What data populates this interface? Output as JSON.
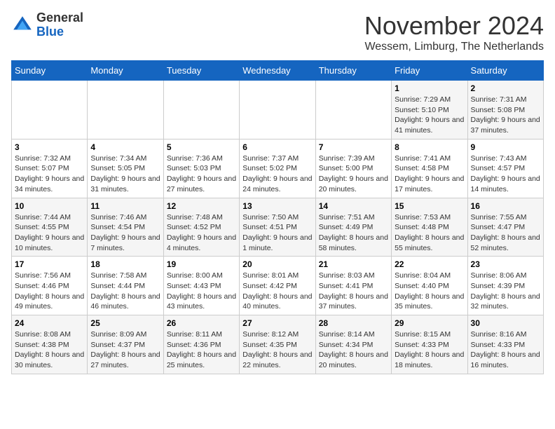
{
  "logo": {
    "general": "General",
    "blue": "Blue"
  },
  "title": "November 2024",
  "subtitle": "Wessem, Limburg, The Netherlands",
  "days_of_week": [
    "Sunday",
    "Monday",
    "Tuesday",
    "Wednesday",
    "Thursday",
    "Friday",
    "Saturday"
  ],
  "weeks": [
    [
      {
        "day": "",
        "info": ""
      },
      {
        "day": "",
        "info": ""
      },
      {
        "day": "",
        "info": ""
      },
      {
        "day": "",
        "info": ""
      },
      {
        "day": "",
        "info": ""
      },
      {
        "day": "1",
        "info": "Sunrise: 7:29 AM\nSunset: 5:10 PM\nDaylight: 9 hours and 41 minutes."
      },
      {
        "day": "2",
        "info": "Sunrise: 7:31 AM\nSunset: 5:08 PM\nDaylight: 9 hours and 37 minutes."
      }
    ],
    [
      {
        "day": "3",
        "info": "Sunrise: 7:32 AM\nSunset: 5:07 PM\nDaylight: 9 hours and 34 minutes."
      },
      {
        "day": "4",
        "info": "Sunrise: 7:34 AM\nSunset: 5:05 PM\nDaylight: 9 hours and 31 minutes."
      },
      {
        "day": "5",
        "info": "Sunrise: 7:36 AM\nSunset: 5:03 PM\nDaylight: 9 hours and 27 minutes."
      },
      {
        "day": "6",
        "info": "Sunrise: 7:37 AM\nSunset: 5:02 PM\nDaylight: 9 hours and 24 minutes."
      },
      {
        "day": "7",
        "info": "Sunrise: 7:39 AM\nSunset: 5:00 PM\nDaylight: 9 hours and 20 minutes."
      },
      {
        "day": "8",
        "info": "Sunrise: 7:41 AM\nSunset: 4:58 PM\nDaylight: 9 hours and 17 minutes."
      },
      {
        "day": "9",
        "info": "Sunrise: 7:43 AM\nSunset: 4:57 PM\nDaylight: 9 hours and 14 minutes."
      }
    ],
    [
      {
        "day": "10",
        "info": "Sunrise: 7:44 AM\nSunset: 4:55 PM\nDaylight: 9 hours and 10 minutes."
      },
      {
        "day": "11",
        "info": "Sunrise: 7:46 AM\nSunset: 4:54 PM\nDaylight: 9 hours and 7 minutes."
      },
      {
        "day": "12",
        "info": "Sunrise: 7:48 AM\nSunset: 4:52 PM\nDaylight: 9 hours and 4 minutes."
      },
      {
        "day": "13",
        "info": "Sunrise: 7:50 AM\nSunset: 4:51 PM\nDaylight: 9 hours and 1 minute."
      },
      {
        "day": "14",
        "info": "Sunrise: 7:51 AM\nSunset: 4:49 PM\nDaylight: 8 hours and 58 minutes."
      },
      {
        "day": "15",
        "info": "Sunrise: 7:53 AM\nSunset: 4:48 PM\nDaylight: 8 hours and 55 minutes."
      },
      {
        "day": "16",
        "info": "Sunrise: 7:55 AM\nSunset: 4:47 PM\nDaylight: 8 hours and 52 minutes."
      }
    ],
    [
      {
        "day": "17",
        "info": "Sunrise: 7:56 AM\nSunset: 4:46 PM\nDaylight: 8 hours and 49 minutes."
      },
      {
        "day": "18",
        "info": "Sunrise: 7:58 AM\nSunset: 4:44 PM\nDaylight: 8 hours and 46 minutes."
      },
      {
        "day": "19",
        "info": "Sunrise: 8:00 AM\nSunset: 4:43 PM\nDaylight: 8 hours and 43 minutes."
      },
      {
        "day": "20",
        "info": "Sunrise: 8:01 AM\nSunset: 4:42 PM\nDaylight: 8 hours and 40 minutes."
      },
      {
        "day": "21",
        "info": "Sunrise: 8:03 AM\nSunset: 4:41 PM\nDaylight: 8 hours and 37 minutes."
      },
      {
        "day": "22",
        "info": "Sunrise: 8:04 AM\nSunset: 4:40 PM\nDaylight: 8 hours and 35 minutes."
      },
      {
        "day": "23",
        "info": "Sunrise: 8:06 AM\nSunset: 4:39 PM\nDaylight: 8 hours and 32 minutes."
      }
    ],
    [
      {
        "day": "24",
        "info": "Sunrise: 8:08 AM\nSunset: 4:38 PM\nDaylight: 8 hours and 30 minutes."
      },
      {
        "day": "25",
        "info": "Sunrise: 8:09 AM\nSunset: 4:37 PM\nDaylight: 8 hours and 27 minutes."
      },
      {
        "day": "26",
        "info": "Sunrise: 8:11 AM\nSunset: 4:36 PM\nDaylight: 8 hours and 25 minutes."
      },
      {
        "day": "27",
        "info": "Sunrise: 8:12 AM\nSunset: 4:35 PM\nDaylight: 8 hours and 22 minutes."
      },
      {
        "day": "28",
        "info": "Sunrise: 8:14 AM\nSunset: 4:34 PM\nDaylight: 8 hours and 20 minutes."
      },
      {
        "day": "29",
        "info": "Sunrise: 8:15 AM\nSunset: 4:33 PM\nDaylight: 8 hours and 18 minutes."
      },
      {
        "day": "30",
        "info": "Sunrise: 8:16 AM\nSunset: 4:33 PM\nDaylight: 8 hours and 16 minutes."
      }
    ]
  ]
}
